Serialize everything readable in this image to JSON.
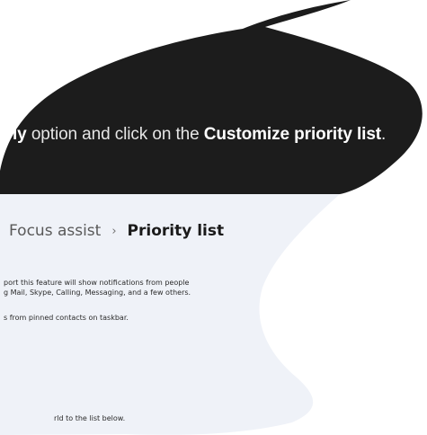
{
  "caption": {
    "prefix": "ly",
    "middle": " option and click on the ",
    "emphasis": "Customize priority list",
    "suffix": "."
  },
  "breadcrumb": {
    "parent": "Focus assist",
    "separator": "›",
    "current": "Priority list"
  },
  "settings_text": {
    "line1": "port this feature will show notifications from people",
    "line2": "g Mail, Skype, Calling, Messaging, and a few others.",
    "line3": "s from pinned contacts on taskbar.",
    "line4": "rld to the list below."
  },
  "colors": {
    "caption_background": "#1c1c1c",
    "settings_background": "#eff2f8",
    "paper_background": "#ffffff"
  }
}
